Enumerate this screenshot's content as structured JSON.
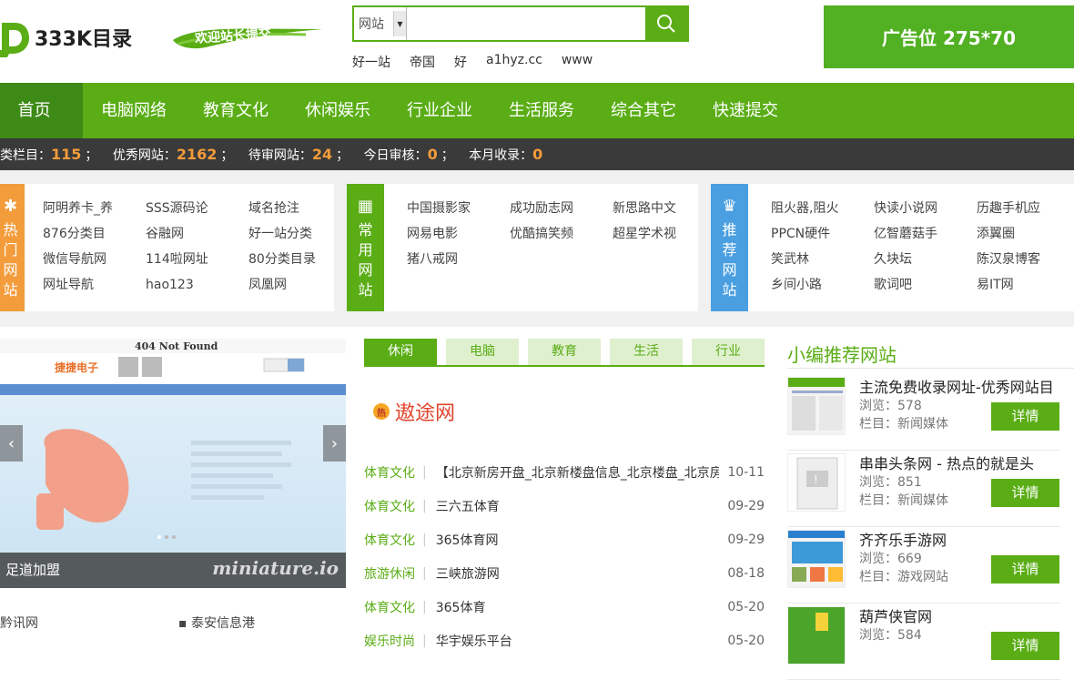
{
  "header": {
    "logo_text": "333K目录",
    "welcome": "欢迎站长提交",
    "search": {
      "select_value": "网站",
      "placeholder": ""
    },
    "hot_keys": [
      "好一站",
      "帝国",
      "好",
      "a1hyz.cc",
      "www"
    ],
    "ad": "广告位 275*70"
  },
  "nav": [
    "首页",
    "电脑网络",
    "教育文化",
    "休闲娱乐",
    "行业企业",
    "生活服务",
    "综合其它",
    "快速提交"
  ],
  "stats": {
    "items": [
      {
        "label": "类栏目：",
        "value": "115"
      },
      {
        "label": "优秀网站：",
        "value": "2162"
      },
      {
        "label": "待审网站：",
        "value": "24"
      },
      {
        "label": "今日审核：",
        "value": "0"
      },
      {
        "label": "本月收录：",
        "value": "0"
      }
    ],
    "separator": "；"
  },
  "categories": {
    "hot": {
      "label": [
        "热",
        "门",
        "网",
        "站"
      ],
      "color": "#f39c3b",
      "rows": [
        [
          "阿明养卡_养",
          "SSS源码论",
          "域名抢注"
        ],
        [
          "876分类目",
          "谷融网",
          "好一站分类"
        ],
        [
          "微信导航网",
          "114啦网址",
          "80分类目录"
        ],
        [
          "网址导航",
          "hao123",
          "凤凰网"
        ]
      ]
    },
    "common": {
      "label": [
        "常",
        "用",
        "网",
        "站"
      ],
      "color": "#5aad15",
      "rows": [
        [
          "中国摄影家",
          "成功励志网",
          "新思路中文"
        ],
        [
          "网易电影",
          "优酷搞笑频",
          "超星学术视"
        ],
        [
          "猪八戒网",
          "",
          ""
        ]
      ]
    },
    "recommend": {
      "label": [
        "推",
        "荐",
        "网",
        "站"
      ],
      "color": "#4a9fe0",
      "rows": [
        [
          "阻火器,阻火",
          "快读小说网",
          "历趣手机应"
        ],
        [
          "PPCN硬件",
          "亿智蘑菇手",
          "添翼圈"
        ],
        [
          "笑武林",
          "久块坛",
          "陈汉泉博客"
        ],
        [
          "乡间小路",
          "歌词吧",
          "易IT网"
        ]
      ]
    }
  },
  "slider": {
    "caption": "足道加盟",
    "watermark": "miniature.io",
    "prev": "‹",
    "next": "›",
    "image_title": "404 Not Found",
    "image_brand": "捷捷电子"
  },
  "below_links": [
    "黔讯网",
    "泰安信息港"
  ],
  "tabs": [
    "休闲",
    "电脑",
    "教育",
    "生活",
    "行业"
  ],
  "featured": {
    "badge": "热",
    "title": "遨途网"
  },
  "news": [
    {
      "cat": "体育文化",
      "title": "【北京新房开盘_北京新楼盘信息_北京楼盘_北京房",
      "date": "10-11"
    },
    {
      "cat": "体育文化",
      "title": "三六五体育",
      "date": "09-29"
    },
    {
      "cat": "体育文化",
      "title": "365体育网",
      "date": "09-29"
    },
    {
      "cat": "旅游休闲",
      "title": "三峡旅游网",
      "date": "08-18"
    },
    {
      "cat": "体育文化",
      "title": "365体育",
      "date": "05-20"
    },
    {
      "cat": "娱乐时尚",
      "title": "华宇娱乐平台",
      "date": "05-20"
    }
  ],
  "recommend": {
    "title": "小编推荐网站",
    "items": [
      {
        "name": "主流免费收录网址-优秀网站目",
        "views_label": "浏览：",
        "views": "578",
        "cat_label": "栏目：",
        "cat": "新闻媒体",
        "btn": "详情"
      },
      {
        "name": "串串头条网 - 热点的就是头",
        "views_label": "浏览：",
        "views": "851",
        "cat_label": "栏目：",
        "cat": "新闻媒体",
        "btn": "详情"
      },
      {
        "name": "齐齐乐手游网",
        "views_label": "浏览：",
        "views": "669",
        "cat_label": "栏目：",
        "cat": "游戏网站",
        "btn": "详情"
      },
      {
        "name": "葫芦侠官网",
        "views_label": "浏览：",
        "views": "584",
        "cat_label": "栏目：",
        "cat": "",
        "btn": "详情"
      }
    ]
  },
  "colors": {
    "green": "#5aad15",
    "dark_green": "#3e8a17",
    "orange": "#f39c3b",
    "blue": "#4a9fe0",
    "stats_bg": "#3a3a3a"
  }
}
